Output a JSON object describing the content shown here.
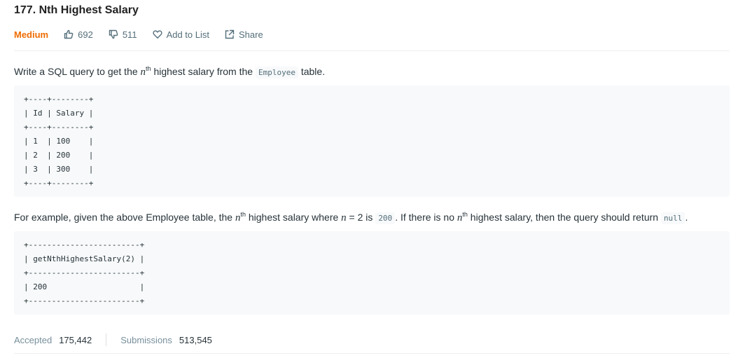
{
  "problem": {
    "title": "177. Nth Highest Salary",
    "difficulty": "Medium",
    "likes": "692",
    "dislikes": "511",
    "add_to_list": "Add to List",
    "share": "Share"
  },
  "description": {
    "p1_before": "Write a SQL query to get the ",
    "p1_n": "n",
    "p1_sup": "th",
    "p1_after": " highest salary from the ",
    "p1_code": "Employee",
    "p1_end": " table.",
    "table1_lines": [
      "+----+--------+",
      "| Id | Salary |",
      "+----+--------+",
      "| 1  | 100    |",
      "| 2  | 200    |",
      "| 3  | 300    |",
      "+----+--------+"
    ],
    "p2_a": "For example, given the above Employee table, the ",
    "p2_n1": "n",
    "p2_sup1": "th",
    "p2_b": " highest salary where ",
    "p2_n2": "n",
    "p2_c": " = 2 is ",
    "p2_code1": "200",
    "p2_d": ". If there is no ",
    "p2_n3": "n",
    "p2_sup2": "th",
    "p2_e": " highest salary, then the query should return ",
    "p2_code2": "null",
    "p2_f": ".",
    "table2_lines": [
      "+------------------------+",
      "| getNthHighestSalary(2) |",
      "+------------------------+",
      "| 200                    |",
      "+------------------------+"
    ]
  },
  "stats": {
    "accepted_label": "Accepted",
    "accepted_value": "175,442",
    "submissions_label": "Submissions",
    "submissions_value": "513,545"
  },
  "colors": {
    "difficulty": "#ef6c00",
    "code_bg": "#f7f9fa"
  }
}
